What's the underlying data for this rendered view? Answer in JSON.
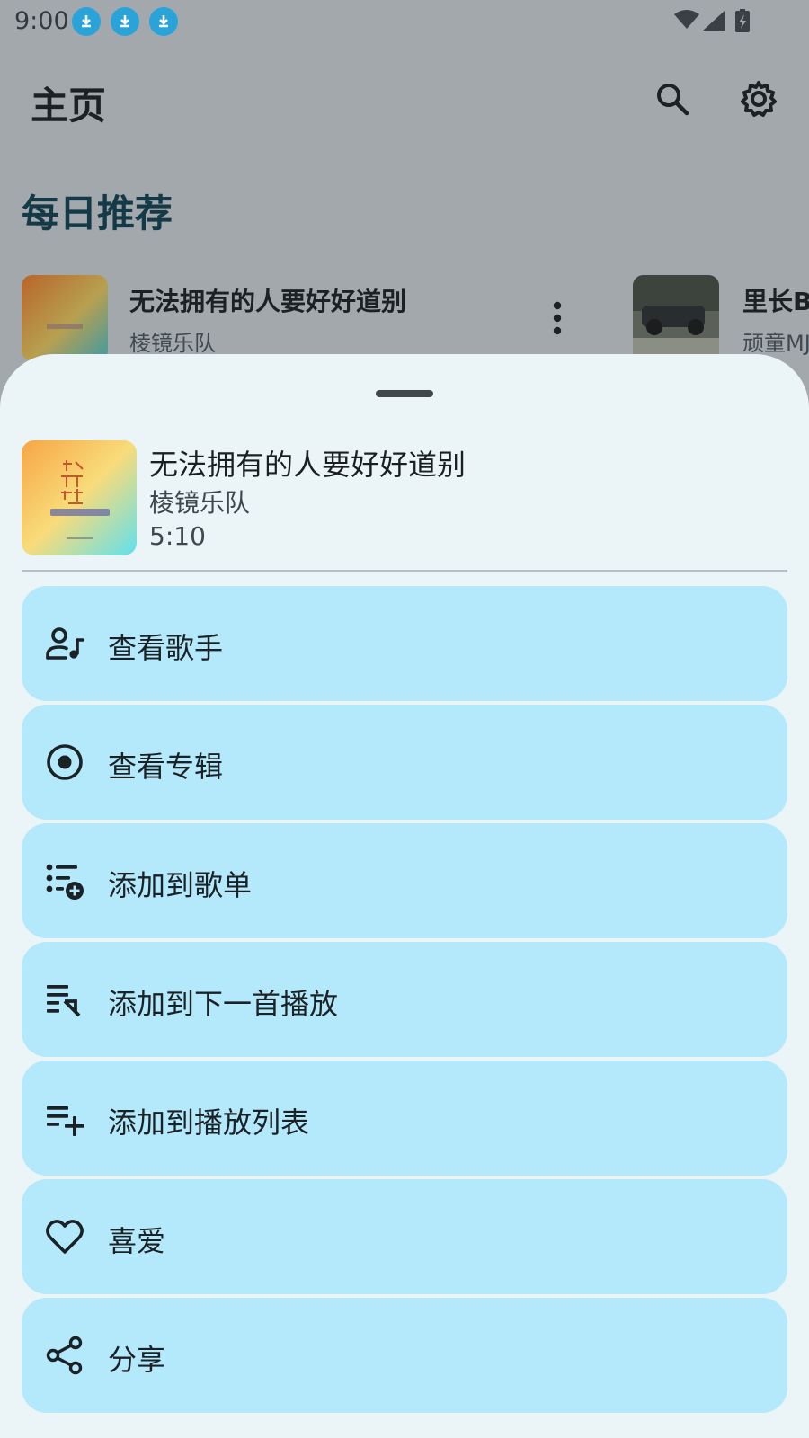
{
  "status_bar": {
    "time": "9:00",
    "notification_icons": [
      "download-icon",
      "download-icon",
      "download-icon"
    ],
    "right_icons": [
      "wifi-icon",
      "signal-icon",
      "battery-charging-icon"
    ]
  },
  "app_bar": {
    "title": "主页",
    "actions": [
      "search-icon",
      "gear-icon"
    ]
  },
  "section": {
    "title": "每日推荐",
    "items": [
      {
        "title": "无法拥有的人要好好道别",
        "artist": "棱镜乐队"
      },
      {
        "title": "里长B",
        "artist": "顽童MJ"
      }
    ]
  },
  "sheet": {
    "song": {
      "title": "无法拥有的人要好好道别",
      "artist": "棱镜乐队",
      "duration": "5:10"
    },
    "actions": [
      {
        "label": "查看歌手",
        "icon": "artist-music-icon"
      },
      {
        "label": "查看专辑",
        "icon": "album-icon"
      },
      {
        "label": "添加到歌单",
        "icon": "playlist-add-icon"
      },
      {
        "label": "添加到下一首播放",
        "icon": "play-next-icon"
      },
      {
        "label": "添加到播放列表",
        "icon": "queue-add-icon"
      },
      {
        "label": "喜爱",
        "icon": "heart-icon"
      },
      {
        "label": "分享",
        "icon": "share-icon"
      }
    ]
  },
  "colors": {
    "scrim_background": "#a3a8ad",
    "sheet_background": "#ebf5f8",
    "action_background": "#b4e8fb",
    "section_title": "#153a47"
  }
}
